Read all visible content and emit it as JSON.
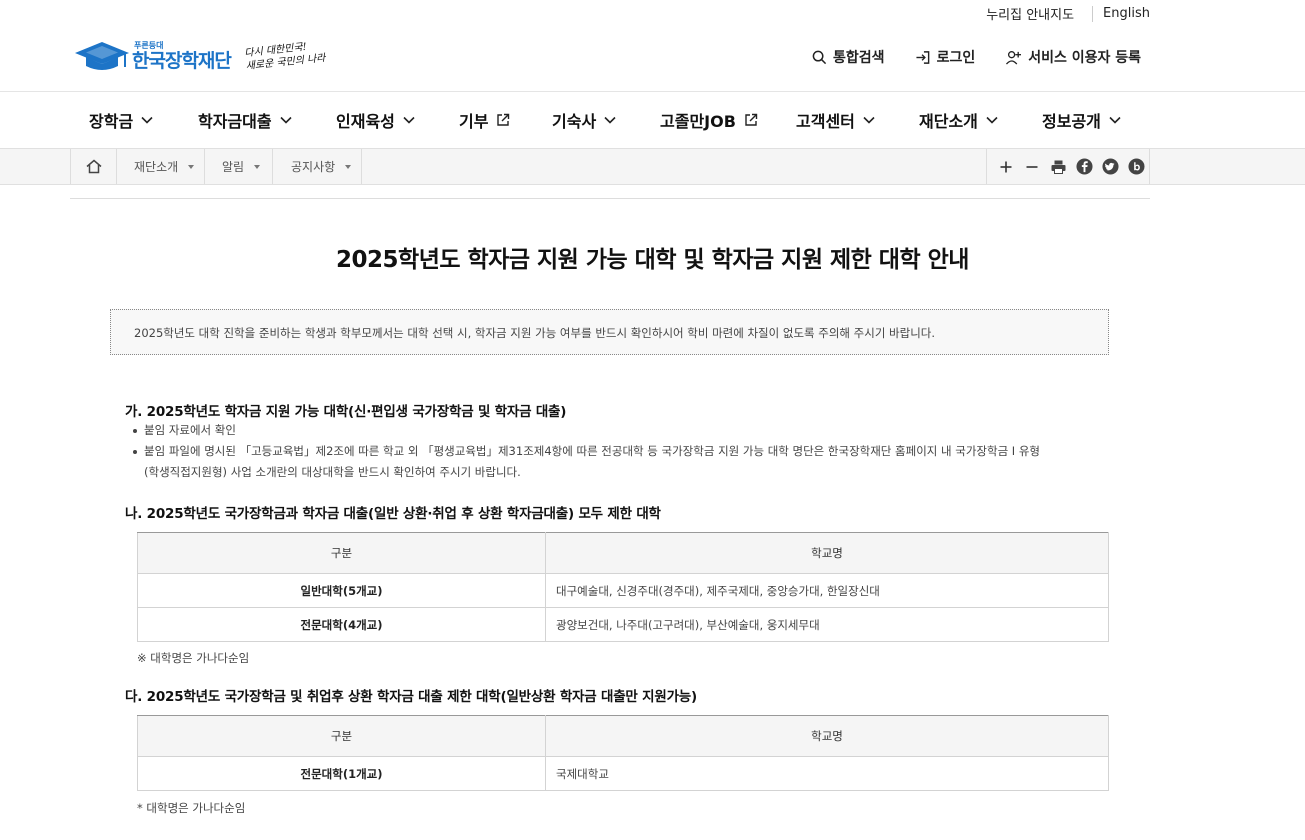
{
  "util_links": [
    "누리집 안내지도",
    "English"
  ],
  "logo": {
    "tagline": "푸른등대",
    "org_name": "한국장학재단",
    "slogan_line1": "다시 대한민국!",
    "slogan_line2": "새로운 국민의 나라"
  },
  "header_actions": [
    {
      "label": "통합검색",
      "icon": "search-icon"
    },
    {
      "label": "로그인",
      "icon": "login-icon"
    },
    {
      "label": "서비스 이용자 등록",
      "icon": "user-add-icon"
    }
  ],
  "nav": [
    {
      "label": "장학금",
      "icon": "chevron-down-icon"
    },
    {
      "label": "학자금대출",
      "icon": "chevron-down-icon"
    },
    {
      "label": "인재육성",
      "icon": "chevron-down-icon"
    },
    {
      "label": "기부",
      "icon": "external-link-icon"
    },
    {
      "label": "기숙사",
      "icon": "chevron-down-icon"
    },
    {
      "label": "고졸만JOB",
      "icon": "external-link-icon"
    },
    {
      "label": "고객센터",
      "icon": "chevron-down-icon"
    },
    {
      "label": "재단소개",
      "icon": "chevron-down-icon"
    },
    {
      "label": "정보공개",
      "icon": "chevron-down-icon"
    }
  ],
  "breadcrumb": [
    "재단소개",
    "알림",
    "공지사항"
  ],
  "tools": [
    "plus-icon",
    "minus-icon",
    "print-icon",
    "facebook-icon",
    "twitter-icon",
    "blog-icon"
  ],
  "colors": {
    "brand_blue": "#1d74c7",
    "text": "#222222"
  },
  "article": {
    "title": "2025학년도 학자금 지원 가능 대학 및 학자금 지원 제한 대학 안내",
    "notice": "2025학년도 대학 진학을 준비하는 학생과 학부모께서는 대학 선택 시, 학자금 지원 가능 여부를 반드시 확인하시어 학비 마련에 차질이 없도록 주의해 주시기 바랍니다.",
    "section_a": {
      "heading": "가. 2025학년도 학자금 지원 가능 대학(신·편입생 국가장학금 및 학자금 대출)",
      "bullet1": "붙임 자료에서 확인",
      "bullet2_line1": "붙임 파일에 명시된 「고등교육법」제2조에 따른 학교 외 「평생교육법」제31조제4항에 따른 전공대학 등 국가장학금 지원 가능 대학 명단은 한국장학재단 홈페이지 내 국가장학금 I 유형",
      "bullet2_line2": "(학생직접지원형) 사업 소개란의 대상대학을 반드시 확인하여 주시기 바랍니다."
    },
    "section_b": {
      "heading": "나. 2025학년도 국가장학금과 학자금 대출(일반 상환·취업 후 상환 학자금대출) 모두 제한 대학",
      "col1": "구분",
      "col2": "학교명",
      "rows": [
        {
          "category": "일반대학(5개교)",
          "schools": "대구예술대, 신경주대(경주대), 제주국제대, 중앙승가대, 한일장신대"
        },
        {
          "category": "전문대학(4개교)",
          "schools": "광양보건대, 나주대(고구려대), 부산예술대, 웅지세무대"
        }
      ],
      "note": "※ 대학명은 가나다순임"
    },
    "section_c": {
      "heading": "다. 2025학년도 국가장학금 및 취업후 상환 학자금 대출 제한 대학(일반상환 학자금 대출만 지원가능)",
      "col1": "구분",
      "col2": "학교명",
      "rows": [
        {
          "category": "전문대학(1개교)",
          "schools": "국제대학교"
        }
      ],
      "note": "* 대학명은 가나다순임"
    }
  }
}
